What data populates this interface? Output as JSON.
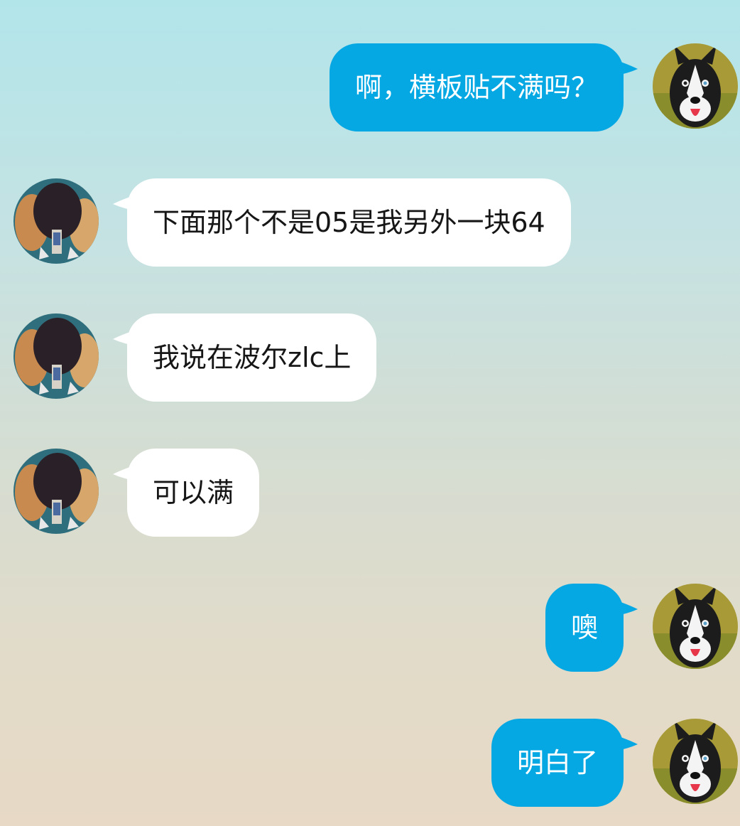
{
  "conversation": {
    "messages": [
      {
        "side": "right",
        "avatar": "husky-dog-avatar",
        "text": "啊，横板贴不满吗？"
      },
      {
        "side": "left",
        "avatar": "ping-pong-paddle-avatar",
        "text": "下面那个不是05是我另外一块64"
      },
      {
        "side": "left",
        "avatar": "ping-pong-paddle-avatar",
        "text": "我说在波尔zlc上"
      },
      {
        "side": "left",
        "avatar": "ping-pong-paddle-avatar",
        "text": "可以满"
      },
      {
        "side": "right",
        "avatar": "husky-dog-avatar",
        "text": "噢"
      },
      {
        "side": "right",
        "avatar": "husky-dog-avatar",
        "text": "明白了"
      }
    ]
  },
  "theme": {
    "outgoing_bubble_color": "#06a8e4",
    "incoming_bubble_color": "#ffffff",
    "outgoing_text_color": "#ffffff",
    "incoming_text_color": "#161616",
    "background_top": "#b2e5ea",
    "background_bottom": "#e7d9c5"
  }
}
